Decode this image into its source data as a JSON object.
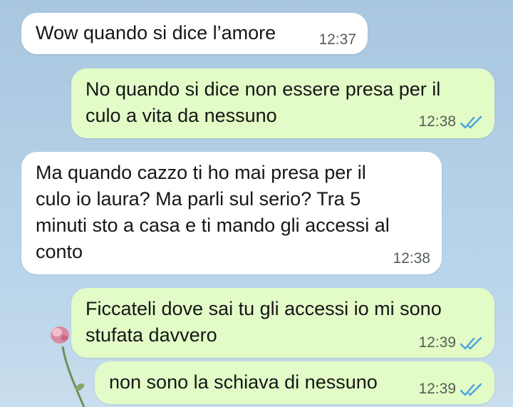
{
  "colors": {
    "incoming_bubble": "#ffffff",
    "outgoing_bubble": "#e2fbc7",
    "read_ticks": "#4aa3df",
    "wallpaper": "#b2cfe6"
  },
  "messages": [
    {
      "direction": "incoming",
      "text": "Wow quando si dice l’amore",
      "time": "12:37"
    },
    {
      "direction": "outgoing",
      "text": "No quando si dice non essere presa per il\nculo a vita da nessuno",
      "time": "12:38",
      "status_icon": "double-check-read-icon"
    },
    {
      "direction": "incoming",
      "text": "Ma quando cazzo ti ho mai presa per il\nculo io laura? Ma parli sul serio? Tra 5\nminuti sto a casa e ti mando gli accessi al\nconto",
      "time": "12:38"
    },
    {
      "direction": "outgoing",
      "text": "Ficcateli dove sai tu gli accessi io mi sono\nstufata davvero",
      "time": "12:39",
      "status_icon": "double-check-read-icon"
    },
    {
      "direction": "outgoing",
      "text": "non sono la schiava di nessuno",
      "time": "12:39",
      "status_icon": "double-check-read-icon"
    }
  ]
}
